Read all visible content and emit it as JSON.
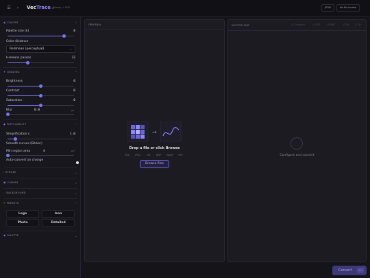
{
  "app": {
    "name_part1": "Vec",
    "name_part2": "Trace",
    "version": "v2",
    "subtitle": "Bitmap → SVG",
    "menu_icon": "hamburger-icon",
    "collapse_icon": "chevron-right-icon",
    "accent": "#8b85ff"
  },
  "toolbar": {
    "format_label": "JSON",
    "file_status": "No file loaded"
  },
  "colors": {
    "header": "COLORS",
    "palette_label": "Palette size (k)",
    "palette_value": "8",
    "palette_level": 0.85,
    "distance_label": "Color distance",
    "distance_value": "Redmean (perceptual)",
    "kmeans_label": "k-means passes",
    "kmeans_value": "12",
    "kmeans_level": 0.3
  },
  "grading": {
    "header": "GRADING",
    "brightness_label": "Brightness",
    "brightness_value": "0",
    "brightness_level": 0.5,
    "contrast_label": "Contrast",
    "contrast_value": "0",
    "contrast_level": 0.5,
    "saturation_label": "Saturation",
    "saturation_value": "0",
    "saturation_level": 0.5,
    "blur_label": "Blur",
    "blur_value": "0.0",
    "blur_unit": "px",
    "blur_level": 0.0
  },
  "path_quality": {
    "header": "PATH QUALITY",
    "simplification_label": "Simplification ε",
    "simplification_value": "1.0",
    "simplification_level": 0.12,
    "smooth_label": "Smooth curves (Bézier)",
    "min_region_label": "Min region area",
    "min_region_value": "4",
    "min_region_unit": "px²",
    "min_region_level": 0.0,
    "auto_convert_label": "Auto-convert on change",
    "auto_convert_on": true
  },
  "stroke": {
    "header": "STROKE"
  },
  "canvas": {
    "header": "CANVAS"
  },
  "background": {
    "header": "BACKGROUND"
  },
  "presets": {
    "header": "PRESETS",
    "items": [
      "Logo",
      "Icon",
      "Photo",
      "Detailed"
    ]
  },
  "palette": {
    "header": "PALETTE"
  },
  "original": {
    "title": "ORIGINAL",
    "drop_title": "Drop a file or click Browse",
    "formats": [
      "PNG",
      "JPEG",
      "GIF",
      "BMP",
      "WebP",
      "TIFF"
    ],
    "browse_label": "Browse files"
  },
  "vector": {
    "title": "VECTOR SVG",
    "tools": [
      "⊙ Compare",
      "↓ SVG",
      "⧉ PNG",
      "⎘ Str",
      "⎘ Cp"
    ],
    "empty_text": "Configure and convert"
  },
  "action": {
    "convert_label": "Convert",
    "shortcut": "⌘↵"
  }
}
